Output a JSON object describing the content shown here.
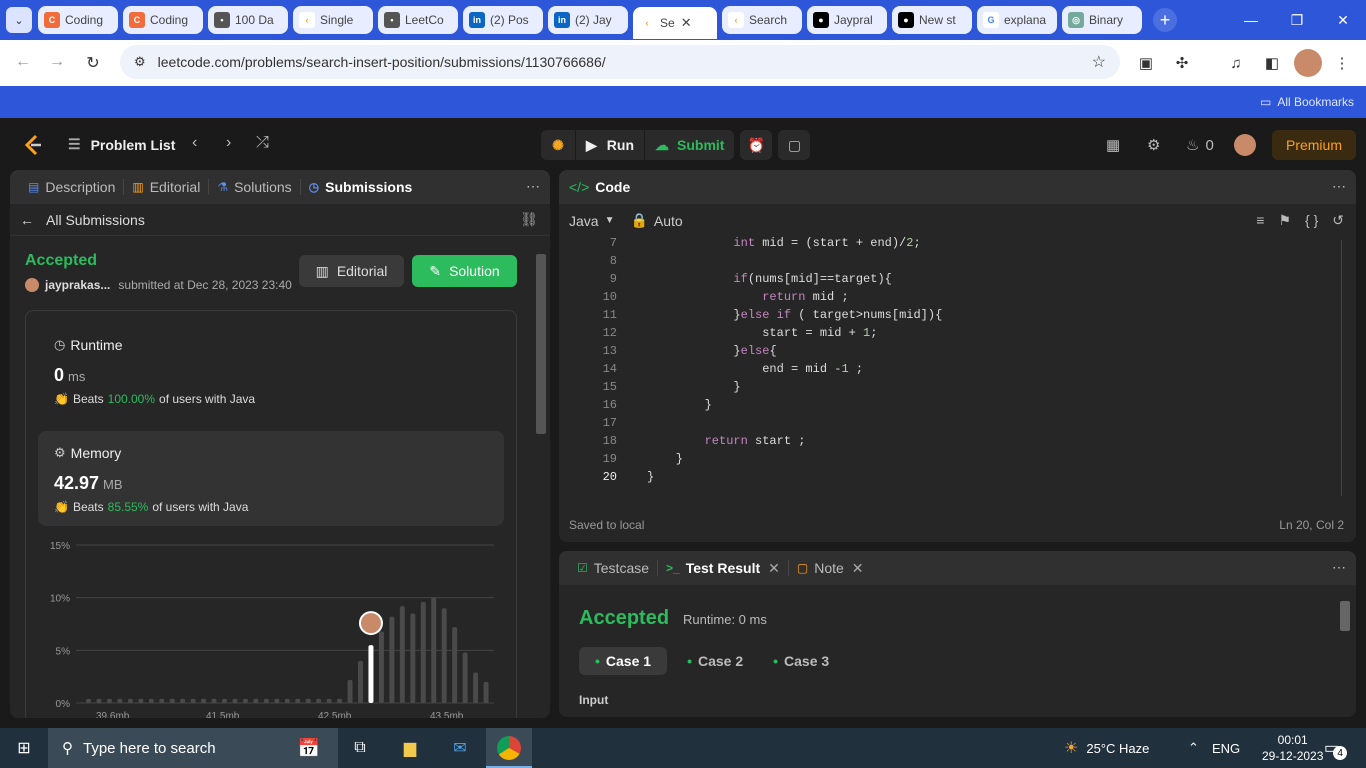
{
  "browser": {
    "tabs": [
      {
        "label": "Coding",
        "fav": "coding-icon"
      },
      {
        "label": "Coding",
        "fav": "coding-icon"
      },
      {
        "label": "100 Da",
        "fav": "site-icon"
      },
      {
        "label": "Single",
        "fav": "leetcode-icon"
      },
      {
        "label": "LeetCo",
        "fav": "site-icon"
      },
      {
        "label": "(2) Pos",
        "fav": "linkedin-icon"
      },
      {
        "label": "(2) Jay",
        "fav": "linkedin-icon"
      },
      {
        "label": "Se",
        "fav": "leetcode-icon"
      },
      {
        "label": "Search",
        "fav": "leetcode-icon"
      },
      {
        "label": "Jaypral",
        "fav": "medium-icon"
      },
      {
        "label": "New st",
        "fav": "medium-icon"
      },
      {
        "label": "explana",
        "fav": "google-icon"
      },
      {
        "label": "Binary",
        "fav": "chatgpt-icon"
      }
    ],
    "url": "leetcode.com/problems/search-insert-position/submissions/1130766686/",
    "bookmarks_label": "All Bookmarks"
  },
  "lc": {
    "problem_list": "Problem List",
    "run": "Run",
    "submit": "Submit",
    "streak": "0",
    "premium": "Premium"
  },
  "left": {
    "tabs": [
      "Description",
      "Editorial",
      "Solutions",
      "Submissions"
    ],
    "all_submissions": "All Submissions",
    "status": "Accepted",
    "user": "jayprakas...",
    "submitted": "submitted at Dec 28, 2023 23:40",
    "editorial_btn": "Editorial",
    "solution_btn": "Solution",
    "runtime": {
      "title": "Runtime",
      "value": "0",
      "unit": "ms",
      "beats_label": "Beats",
      "beats_pct": "100.00%",
      "suffix": "of users with Java"
    },
    "memory": {
      "title": "Memory",
      "value": "42.97",
      "unit": "MB",
      "beats_label": "Beats",
      "beats_pct": "85.55%",
      "suffix": "of users with Java"
    }
  },
  "chart_data": {
    "type": "bar",
    "ylim": [
      0,
      15
    ],
    "yticks": [
      "15%",
      "10%",
      "5%",
      "0%"
    ],
    "xticks": [
      "39.6mb",
      "41.5mb",
      "42.5mb",
      "43.5mb"
    ],
    "values": [
      0.4,
      0.4,
      0.4,
      0.4,
      0.4,
      0.4,
      0.4,
      0.4,
      0.4,
      0.4,
      0.4,
      0.4,
      0.4,
      0.4,
      0.4,
      0.4,
      0.4,
      0.4,
      0.4,
      0.4,
      0.4,
      0.4,
      0.4,
      0.4,
      0.4,
      2.2,
      4.0,
      5.5,
      6.8,
      8.2,
      9.2,
      8.5,
      9.6,
      10.0,
      9.0,
      7.2,
      4.8,
      2.9,
      2.0
    ],
    "highlight_index": 27
  },
  "code": {
    "title": "Code",
    "language": "Java",
    "auto": "Auto",
    "lines": [
      {
        "n": "7",
        "t": "            int mid = (start + end)/2;"
      },
      {
        "n": "8",
        "t": ""
      },
      {
        "n": "9",
        "t": "            if(nums[mid]==target){"
      },
      {
        "n": "10",
        "t": "                return mid ;"
      },
      {
        "n": "11",
        "t": "            }else if ( target>nums[mid]){"
      },
      {
        "n": "12",
        "t": "                start = mid + 1;"
      },
      {
        "n": "13",
        "t": "            }else{"
      },
      {
        "n": "14",
        "t": "                end = mid -1 ;"
      },
      {
        "n": "15",
        "t": "            }"
      },
      {
        "n": "16",
        "t": "        }"
      },
      {
        "n": "17",
        "t": ""
      },
      {
        "n": "18",
        "t": "        return start ;"
      },
      {
        "n": "19",
        "t": "    }"
      },
      {
        "n": "20",
        "t": "}"
      }
    ],
    "saved": "Saved to local",
    "cursor": "Ln 20, Col 2"
  },
  "result": {
    "tabs": [
      "Testcase",
      "Test Result",
      "Note"
    ],
    "status": "Accepted",
    "runtime": "Runtime: 0 ms",
    "cases": [
      "Case 1",
      "Case 2",
      "Case 3"
    ],
    "input_label": "Input"
  },
  "taskbar": {
    "search_placeholder": "Type here to search",
    "weather": "25°C  Haze",
    "lang": "ENG",
    "time": "00:01",
    "date": "29-12-2023",
    "notif": "4"
  }
}
